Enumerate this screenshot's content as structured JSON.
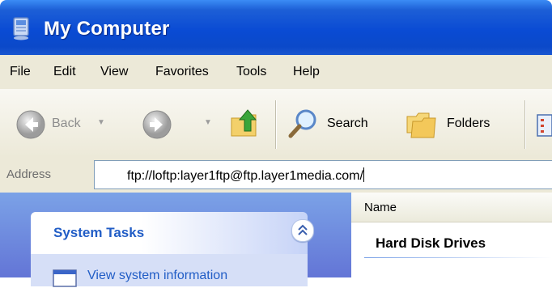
{
  "window": {
    "title": "My Computer",
    "icon": "my-computer-icon"
  },
  "menu": {
    "items": [
      "File",
      "Edit",
      "View",
      "Favorites",
      "Tools",
      "Help"
    ]
  },
  "toolbar": {
    "back_label": "Back",
    "search_label": "Search",
    "folders_label": "Folders"
  },
  "address": {
    "label": "Address",
    "value": "ftp://loftp:layer1ftp@ftp.layer1media.com/"
  },
  "left_pane": {
    "panel_title": "System Tasks",
    "task_item": "View system information"
  },
  "right_pane": {
    "column_header": "Name",
    "group_title": "Hard Disk Drives"
  }
}
